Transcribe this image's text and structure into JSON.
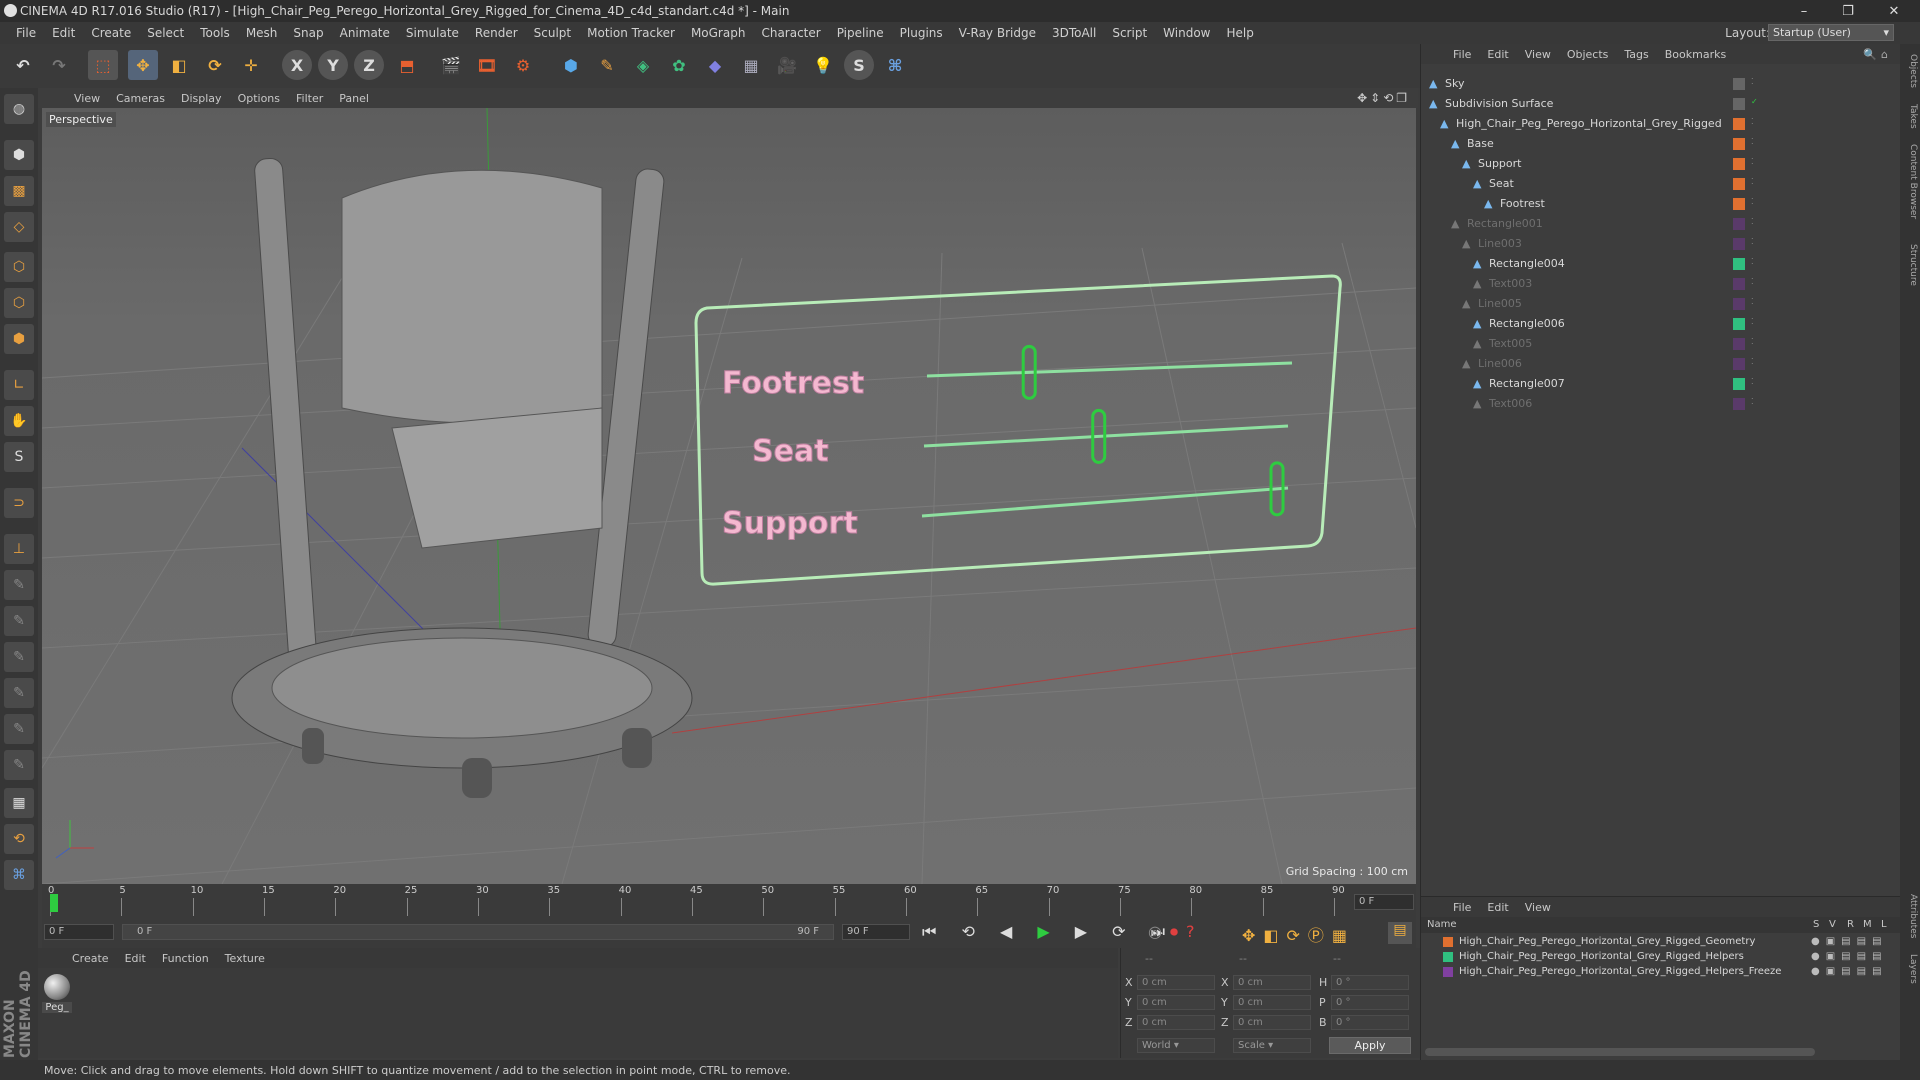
{
  "window": {
    "title": "CINEMA 4D R17.016 Studio (R17) - [High_Chair_Peg_Perego_Horizontal_Grey_Rigged_for_Cinema_4D_c4d_standart.c4d *] - Main"
  },
  "menubar": [
    "File",
    "Edit",
    "Create",
    "Select",
    "Tools",
    "Mesh",
    "Snap",
    "Animate",
    "Simulate",
    "Render",
    "Sculpt",
    "Motion Tracker",
    "MoGraph",
    "Character",
    "Pipeline",
    "Plugins",
    "V-Ray Bridge",
    "3DToAll",
    "Script",
    "Window",
    "Help"
  ],
  "layout": {
    "label": "Layout:",
    "value": "Startup (User)"
  },
  "viewport": {
    "menu": [
      "View",
      "Cameras",
      "Display",
      "Options",
      "Filter",
      "Panel"
    ],
    "label": "Perspective",
    "grid_spacing": "Grid Spacing : 100 cm",
    "scene_labels": [
      "Footrest",
      "Seat",
      "Support"
    ],
    "slider_levels": {
      "Footrest": 0.28,
      "Seat": 0.48,
      "Support": 0.97
    }
  },
  "timeline": {
    "ticks": [
      "0",
      "5",
      "10",
      "15",
      "20",
      "25",
      "30",
      "35",
      "40",
      "45",
      "50",
      "55",
      "60",
      "65",
      "70",
      "75",
      "80",
      "85",
      "90"
    ],
    "current_frame": "0 F",
    "start_field": "0 F",
    "range_start": "0 F",
    "range_end": "90 F",
    "end_field": "90 F"
  },
  "material_manager": {
    "menu": [
      "Create",
      "Edit",
      "Function",
      "Texture"
    ],
    "materials": [
      {
        "name": "Peg_"
      }
    ]
  },
  "coordinates": {
    "header_left": "--",
    "header_mid": "--",
    "header_right": "--",
    "rows": [
      {
        "axis": "X",
        "pos": "0 cm",
        "axis2": "X",
        "size": "0 cm",
        "rot_label": "H",
        "rot": "0 °"
      },
      {
        "axis": "Y",
        "pos": "0 cm",
        "axis2": "Y",
        "size": "0 cm",
        "rot_label": "P",
        "rot": "0 °"
      },
      {
        "axis": "Z",
        "pos": "0 cm",
        "axis2": "Z",
        "size": "0 cm",
        "rot_label": "B",
        "rot": "0 °"
      }
    ],
    "mode_world": "World",
    "mode_scale": "Scale",
    "apply": "Apply"
  },
  "object_manager": {
    "menu": [
      "File",
      "Edit",
      "View",
      "Objects",
      "Tags",
      "Bookmarks"
    ],
    "objects": [
      {
        "name": "Sky",
        "depth": 0,
        "dim": false
      },
      {
        "name": "Subdivision Surface",
        "depth": 0,
        "dim": false
      },
      {
        "name": "High_Chair_Peg_Perego_Horizontal_Grey_Rigged",
        "depth": 1,
        "dim": false
      },
      {
        "name": "Base",
        "depth": 2,
        "dim": false
      },
      {
        "name": "Support",
        "depth": 3,
        "dim": false
      },
      {
        "name": "Seat",
        "depth": 4,
        "dim": false
      },
      {
        "name": "Footrest",
        "depth": 5,
        "dim": false
      },
      {
        "name": "Rectangle001",
        "depth": 2,
        "dim": true
      },
      {
        "name": "Line003",
        "depth": 3,
        "dim": true
      },
      {
        "name": "Rectangle004",
        "depth": 4,
        "dim": false
      },
      {
        "name": "Text003",
        "depth": 4,
        "dim": true
      },
      {
        "name": "Line005",
        "depth": 3,
        "dim": true
      },
      {
        "name": "Rectangle006",
        "depth": 4,
        "dim": false
      },
      {
        "name": "Text005",
        "depth": 4,
        "dim": true
      },
      {
        "name": "Line006",
        "depth": 3,
        "dim": true
      },
      {
        "name": "Rectangle007",
        "depth": 4,
        "dim": false
      },
      {
        "name": "Text006",
        "depth": 4,
        "dim": true
      }
    ]
  },
  "layer_manager": {
    "menu": [
      "File",
      "Edit",
      "View"
    ],
    "columns": {
      "name": "Name",
      "s": "S",
      "v": "V",
      "r": "R",
      "m": "M",
      "l": "L"
    },
    "layers": [
      {
        "name": "High_Chair_Peg_Perego_Horizontal_Grey_Rigged_Geometry",
        "color": "#e07030"
      },
      {
        "name": "High_Chair_Peg_Perego_Horizontal_Grey_Rigged_Helpers",
        "color": "#30c080"
      },
      {
        "name": "High_Chair_Peg_Perego_Horizontal_Grey_Rigged_Helpers_Freeze",
        "color": "#8040a0"
      }
    ]
  },
  "side_tabs": [
    "Objects",
    "Takes",
    "Content Browser",
    "Structure",
    "Attributes",
    "Layers"
  ],
  "status": "Move: Click and drag to move elements. Hold down SHIFT to quantize movement / add to the selection in point mode, CTRL to remove.",
  "brand": "MAXON CINEMA 4D",
  "colors": {
    "accent": "#e07030",
    "helper": "#30c080",
    "ui_bg": "#3c3c3c"
  }
}
